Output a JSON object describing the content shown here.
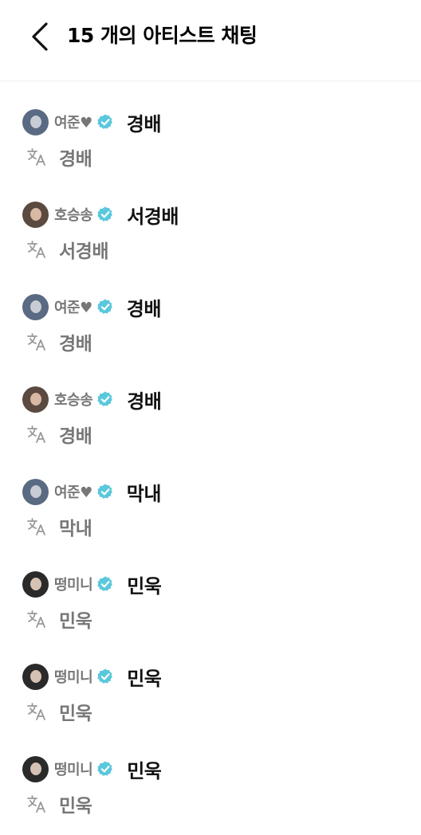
{
  "header": {
    "title": "15 개의 아티스트 채팅"
  },
  "colors": {
    "verified_badge": "#5ac8dc",
    "nickname": "#777777",
    "message": "#111111",
    "translation": "#777777",
    "translate_icon": "#999999"
  },
  "icons": {
    "back": "chevron-left-icon",
    "verified": "verified-badge-icon",
    "translate": "translate-icon"
  },
  "messages": [
    {
      "nickname": "여준♥",
      "text": "경배",
      "translation": "경배",
      "avatar_bg": "#596a82",
      "avatar_face": "#c8ccd4"
    },
    {
      "nickname": "호승송",
      "text": "서경배",
      "translation": "서경배",
      "avatar_bg": "#5a4a3f",
      "avatar_face": "#d9b8a4"
    },
    {
      "nickname": "여준♥",
      "text": "경배",
      "translation": "경배",
      "avatar_bg": "#596a82",
      "avatar_face": "#c8ccd4"
    },
    {
      "nickname": "호승송",
      "text": "경배",
      "translation": "경배",
      "avatar_bg": "#5a4a3f",
      "avatar_face": "#d9b8a4"
    },
    {
      "nickname": "여준♥",
      "text": "막내",
      "translation": "막내",
      "avatar_bg": "#596a82",
      "avatar_face": "#c8ccd4"
    },
    {
      "nickname": "떵미니",
      "text": "민욱",
      "translation": "민욱",
      "avatar_bg": "#2a2a2a",
      "avatar_face": "#d6c2b4"
    },
    {
      "nickname": "떵미니",
      "text": "민욱",
      "translation": "민욱",
      "avatar_bg": "#2a2a2a",
      "avatar_face": "#d6c2b4"
    },
    {
      "nickname": "떵미니",
      "text": "민욱",
      "translation": "민욱",
      "avatar_bg": "#2a2a2a",
      "avatar_face": "#d6c2b4"
    }
  ]
}
